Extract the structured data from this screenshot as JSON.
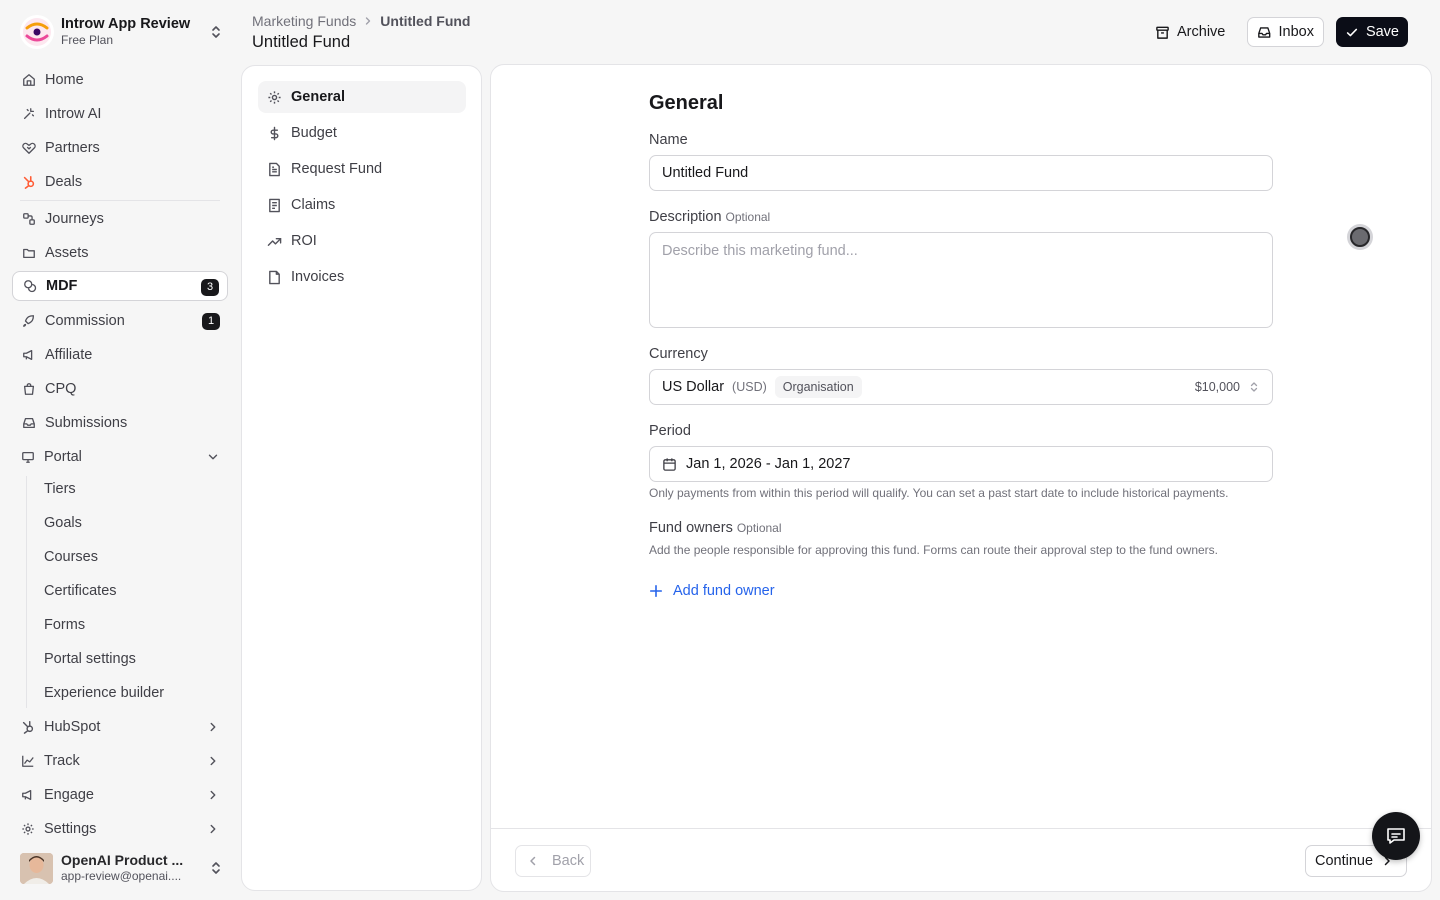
{
  "org": {
    "name": "Introw App Review",
    "plan": "Free Plan"
  },
  "sidebar": {
    "items": [
      {
        "label": "Home"
      },
      {
        "label": "Introw AI"
      },
      {
        "label": "Partners"
      },
      {
        "label": "Deals"
      },
      {
        "label": "Journeys"
      },
      {
        "label": "Assets"
      },
      {
        "label": "MDF",
        "count": "3"
      },
      {
        "label": "Commission",
        "count": "1"
      },
      {
        "label": "Affiliate"
      },
      {
        "label": "CPQ"
      },
      {
        "label": "Submissions"
      },
      {
        "label": "Portal"
      }
    ],
    "portal_children": [
      "Tiers",
      "Goals",
      "Courses",
      "Certificates",
      "Forms",
      "Portal settings",
      "Experience builder"
    ],
    "groups": [
      {
        "label": "HubSpot"
      },
      {
        "label": "Track"
      },
      {
        "label": "Engage"
      },
      {
        "label": "Settings"
      }
    ]
  },
  "user": {
    "name": "OpenAI Product ...",
    "email": "app-review@openai...."
  },
  "header": {
    "breadcrumb_parent": "Marketing Funds",
    "breadcrumb_current": "Untitled Fund",
    "title": "Untitled Fund",
    "archive_label": "Archive",
    "inbox_label": "Inbox",
    "save_label": "Save"
  },
  "sections": [
    "General",
    "Budget",
    "Request Fund",
    "Claims",
    "ROI",
    "Invoices"
  ],
  "form": {
    "title": "General",
    "name_label": "Name",
    "name_value": "Untitled Fund",
    "description_label": "Description",
    "optional_tag": "Optional",
    "description_placeholder": "Describe this marketing fund...",
    "currency_label": "Currency",
    "currency_name": "US Dollar",
    "currency_code": "(USD)",
    "currency_badge": "Organisation",
    "currency_amount": "$10,000",
    "period_label": "Period",
    "period_value": "Jan 1, 2026 - Jan 1, 2027",
    "period_hint": "Only payments from within this period will qualify. You can set a past start date to include historical payments.",
    "owners_label": "Fund owners",
    "owners_hint": "Add the people responsible for approving this fund. Forms can route their approval step to the fund owners.",
    "add_owner_label": "Add fund owner"
  },
  "footer": {
    "back_label": "Back",
    "continue_label": "Continue"
  },
  "colors": {
    "accent": "#2563eb",
    "primary_button": "#0b0d17",
    "badge": "#18181b"
  }
}
